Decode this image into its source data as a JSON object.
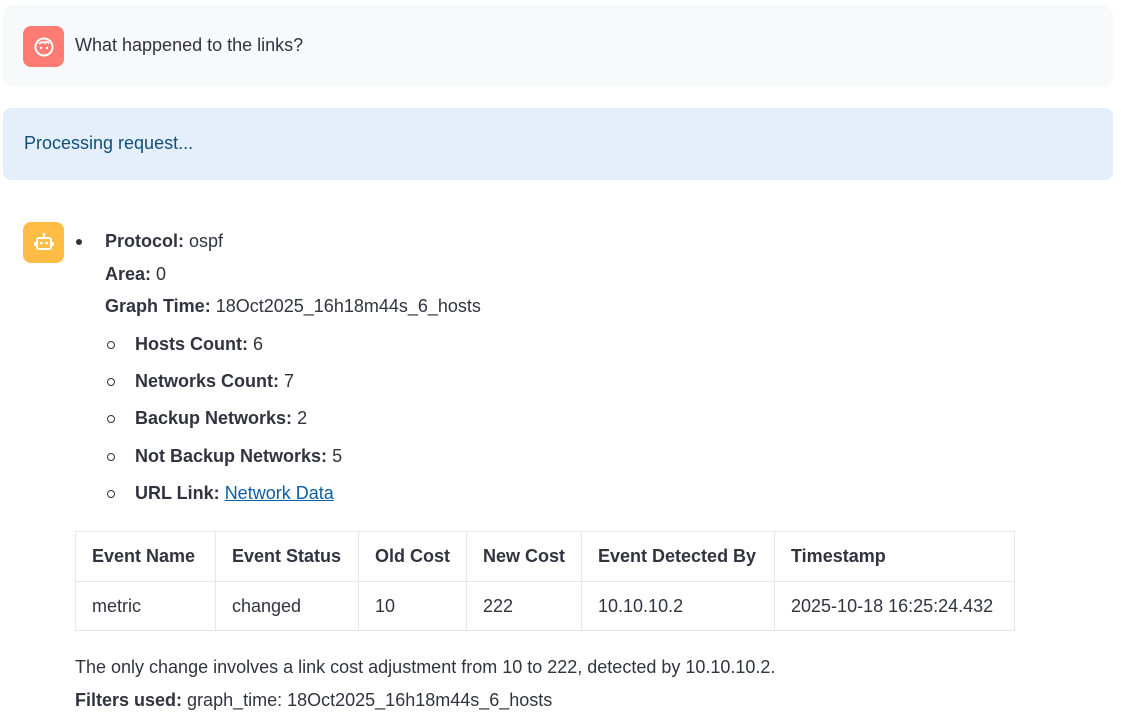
{
  "user_message": {
    "text": "What happened to the links?",
    "avatar_icon": "user-face-icon",
    "avatar_color": "#ff7c74"
  },
  "status": {
    "text": "Processing request..."
  },
  "bot": {
    "avatar_icon": "robot-icon",
    "avatar_color": "#ffbd45",
    "protocol": {
      "label": "Protocol:",
      "value": "ospf"
    },
    "area": {
      "label": "Area:",
      "value": "0"
    },
    "graph_time": {
      "label": "Graph Time:",
      "value": "18Oct2025_16h18m44s_6_hosts"
    },
    "sub_items": [
      {
        "label": "Hosts Count:",
        "value": "6"
      },
      {
        "label": "Networks Count:",
        "value": "7"
      },
      {
        "label": "Backup Networks:",
        "value": "2"
      },
      {
        "label": "Not Backup Networks:",
        "value": "5"
      }
    ],
    "url_link": {
      "label": "URL Link:",
      "link_text": "Network Data"
    },
    "table": {
      "headers": [
        "Event Name",
        "Event Status",
        "Old Cost",
        "New Cost",
        "Event Detected By",
        "Timestamp"
      ],
      "rows": [
        [
          "metric",
          "changed",
          "10",
          "222",
          "10.10.10.2",
          "2025-10-18 16:25:24.432"
        ]
      ]
    },
    "summary": "The only change involves a link cost adjustment from 10 to 222, detected by 10.10.10.2.",
    "filters": {
      "label": "Filters used:",
      "value": "graph_time: 18Oct2025_16h18m44s_6_hosts"
    }
  }
}
